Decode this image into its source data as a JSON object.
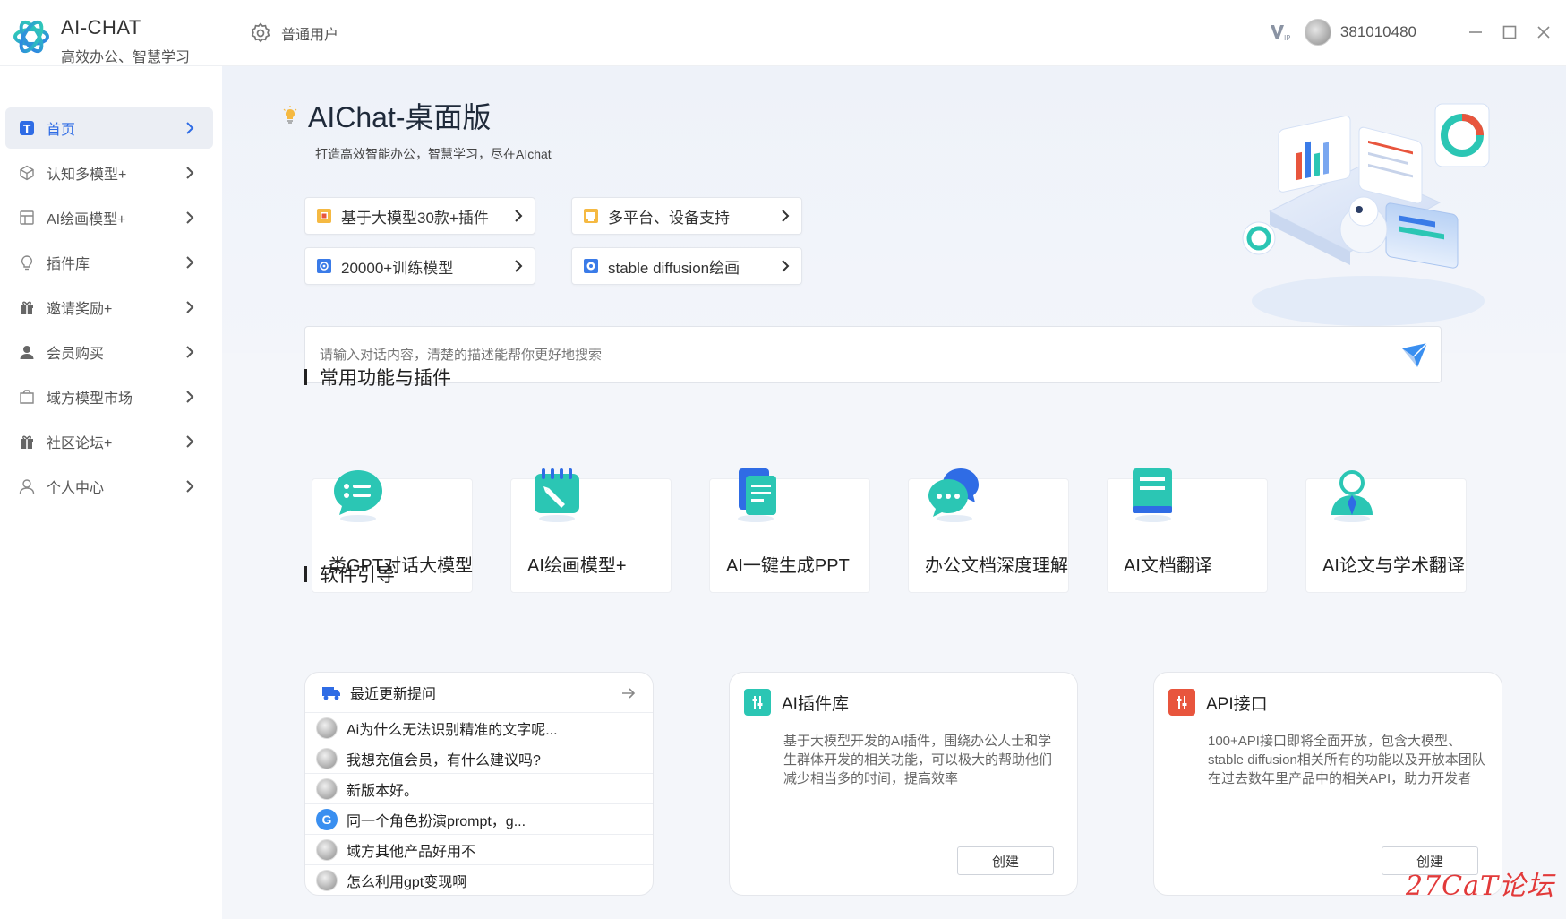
{
  "app": {
    "name": "AI-CHAT",
    "tagline": "高效办公、智慧学习"
  },
  "topbar": {
    "user_role": "普通用户",
    "user_id": "381010480"
  },
  "sidebar": {
    "items": [
      {
        "label": "首页",
        "icon": "home-icon",
        "active": true
      },
      {
        "label": "认知多模型+",
        "icon": "cube-icon"
      },
      {
        "label": "AI绘画模型+",
        "icon": "image-icon"
      },
      {
        "label": "插件库",
        "icon": "bulb-icon"
      },
      {
        "label": "邀请奖励+",
        "icon": "gift-icon"
      },
      {
        "label": "会员购买",
        "icon": "user-icon"
      },
      {
        "label": "域方模型市场",
        "icon": "bag-icon"
      },
      {
        "label": "社区论坛+",
        "icon": "gift-icon"
      },
      {
        "label": "个人中心",
        "icon": "person-icon"
      }
    ]
  },
  "hero": {
    "title": "AIChat-桌面版",
    "subtitle": "打造高效智能办公，智慧学习，尽在AIchat",
    "features": [
      {
        "label": "基于大模型30款+插件"
      },
      {
        "label": "多平台、设备支持"
      },
      {
        "label": "20000+训练模型"
      },
      {
        "label": "stable diffusion绘画"
      }
    ]
  },
  "search": {
    "placeholder": "请输入对话内容，清楚的描述能帮你更好地搜索"
  },
  "tools_section": {
    "title": "常用功能与插件",
    "items": [
      {
        "label": "类GPT对话大模型",
        "icon": "chat-bubble-icon"
      },
      {
        "label": "AI绘画模型+",
        "icon": "paint-notepad-icon"
      },
      {
        "label": "AI一键生成PPT",
        "icon": "document-icon"
      },
      {
        "label": "办公文档深度理解",
        "icon": "conversation-icon"
      },
      {
        "label": "AI文档翻译",
        "icon": "book-icon"
      },
      {
        "label": "AI论文与学术翻译",
        "icon": "scholar-icon"
      }
    ]
  },
  "guide_section": {
    "title": "软件引导",
    "recent": {
      "title": "最近更新提问",
      "items": [
        "Ai为什么无法识别精准的文字呢...",
        "我想充值会员，有什么建议吗?",
        "新版本好。",
        "同一个角色扮演prompt，g...",
        "域方其他产品好用不",
        "怎么利用gpt变现啊"
      ]
    },
    "plugins": {
      "title": "AI插件库",
      "desc": "基于大模型开发的AI插件，围绕办公人士和学生群体开发的相关功能，可以极大的帮助他们减少相当多的时间，提高效率",
      "button": "创建"
    },
    "api": {
      "title": "API接口",
      "desc": "100+API接口即将全面开放，包含大模型、stable diffusion相关所有的功能以及开放本团队在过去数年里产品中的相关API，助力开发者",
      "button": "创建"
    }
  },
  "watermark": "27CaT论坛",
  "colors": {
    "accent": "#2f6ce5",
    "teal": "#2bc6b4",
    "orange_red": "#e8553d"
  }
}
